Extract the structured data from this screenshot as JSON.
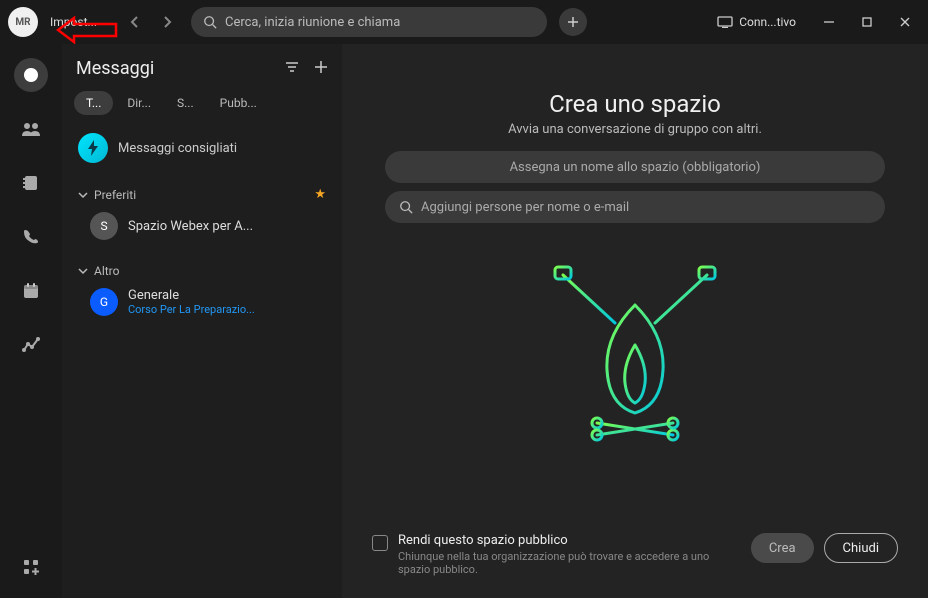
{
  "titlebar": {
    "avatar_initials": "MR",
    "status_label": "Impost...",
    "search_placeholder": "Cerca, inizia riunione e chiama",
    "device_status": "Conn...tivo"
  },
  "sidebar": {
    "title": "Messaggi",
    "tabs": {
      "all": "T...",
      "direct": "Dir...",
      "spaces": "S...",
      "public": "Pubb..."
    },
    "suggested": "Messaggi consigliati",
    "sections": {
      "favorites": {
        "label": "Preferiti"
      },
      "other": {
        "label": "Altro"
      }
    },
    "spaces": {
      "webex": {
        "initial": "S",
        "name": "Spazio Webex per A..."
      },
      "generale": {
        "initial": "G",
        "name": "Generale",
        "sub": "Corso Per La Preparazio..."
      }
    }
  },
  "content": {
    "title": "Crea uno spazio",
    "subtitle": "Avvia una conversazione di gruppo con altri.",
    "name_placeholder": "Assegna un nome allo spazio (obbligatorio)",
    "people_placeholder": "Aggiungi persone per nome o e-mail",
    "public_label": "Rendi questo spazio pubblico",
    "public_desc": "Chiunque nella tua organizzazione può trovare e accedere a uno spazio pubblico.",
    "create": "Crea",
    "close": "Chiudi"
  }
}
